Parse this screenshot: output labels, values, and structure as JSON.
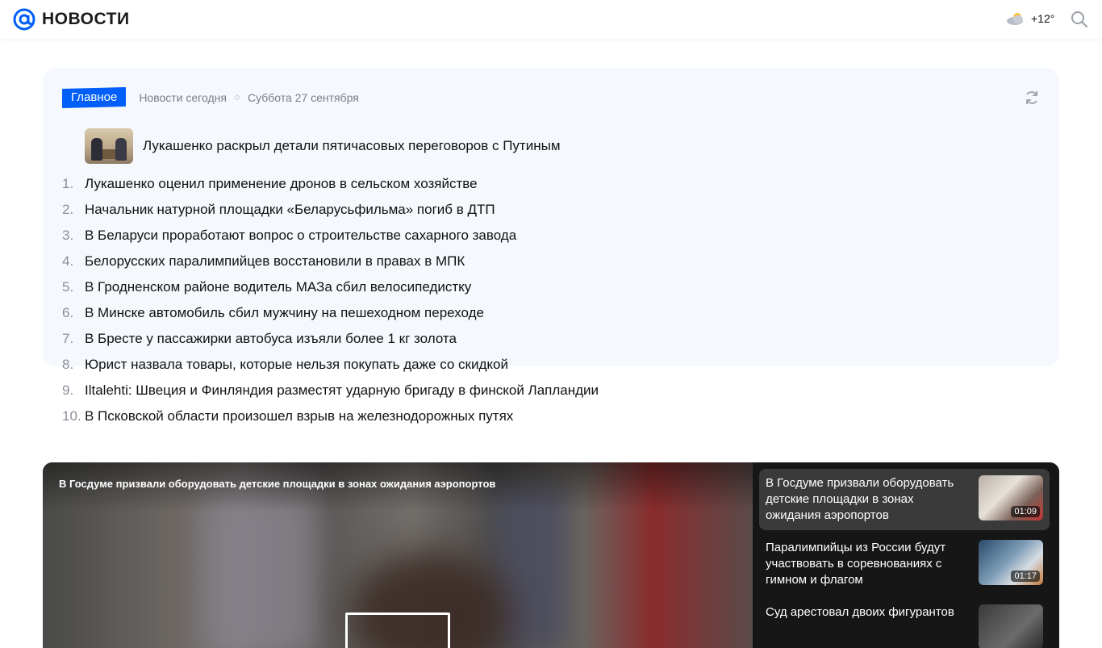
{
  "header": {
    "logo_text": "НОВОСТИ",
    "weather_temp": "+12°"
  },
  "colors": {
    "accent": "#005ff9",
    "card_bg": "#f5f8fd"
  },
  "news": {
    "badge": "Главное",
    "subtitle": "Новости сегодня",
    "date": "Суббота 27 сентября",
    "lead": "Лукашенко раскрыл детали пятичасовых переговоров с Путиным",
    "items": [
      {
        "num": "1.",
        "text": "Лукашенко оценил применение дронов в сельском хозяйстве"
      },
      {
        "num": "2.",
        "text": "Начальник натурной площадки «Беларусьфильма» погиб в ДТП"
      },
      {
        "num": "3.",
        "text": "В Беларуси проработают вопрос о строительстве сахарного завода"
      },
      {
        "num": "4.",
        "text": "Белорусских паралимпийцев восстановили в правах в МПК"
      },
      {
        "num": "5.",
        "text": "В Гродненском районе водитель МАЗа сбил велосипедистку"
      },
      {
        "num": "6.",
        "text": "В Минске автомобиль сбил мужчину на пешеходном переходе"
      },
      {
        "num": "7.",
        "text": "В Бресте у пассажирки автобуса изъяли более 1 кг золота"
      },
      {
        "num": "8.",
        "text": "Юрист назвала товары, которые нельзя покупать даже со скидкой"
      },
      {
        "num": "9.",
        "text": "Iltalehti: Швеция и Финляндия разместят ударную бригаду в финской Лапландии"
      },
      {
        "num": "10.",
        "text": "В Псковской области произошел взрыв на железнодорожных путях"
      }
    ]
  },
  "video": {
    "player_title": "В Госдуме призвали оборудовать детские площадки в зонах ожидания аэропортов",
    "playlist": [
      {
        "title": "В Госдуме призвали оборудовать детские площадки в зонах ожидания аэропортов",
        "duration": "01:09",
        "active": true
      },
      {
        "title": "Паралимпийцы из России будут участвовать в соревнованиях с гимном и флагом",
        "duration": "01:17",
        "active": false
      },
      {
        "title": "Суд арестовал двоих фигурантов",
        "duration": "",
        "active": false
      }
    ]
  }
}
